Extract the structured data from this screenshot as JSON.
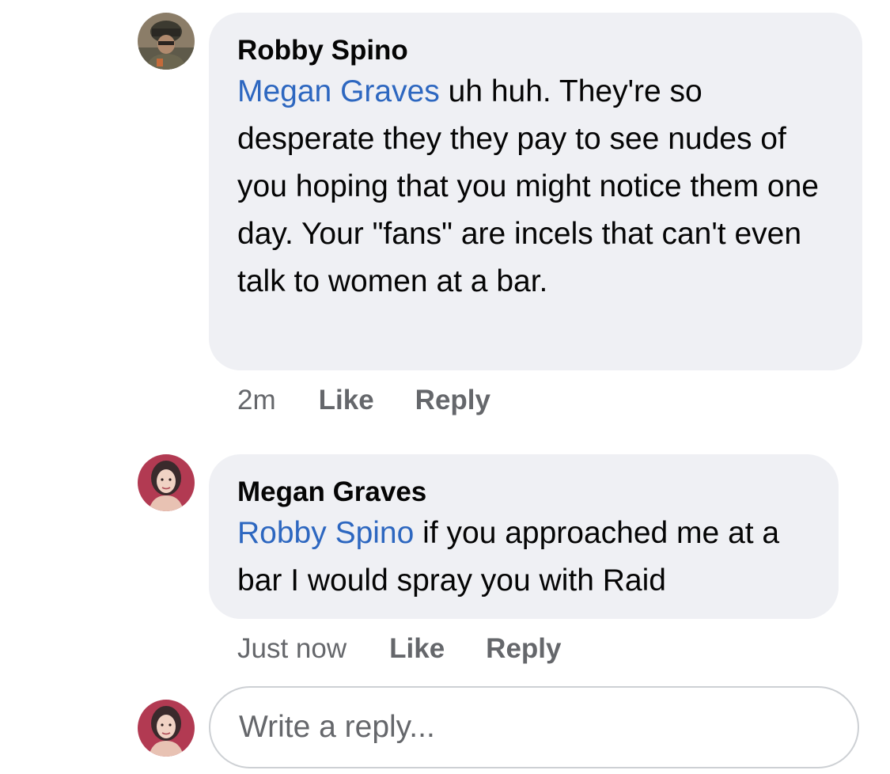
{
  "comments": [
    {
      "author": "Robby Spino",
      "mention": "Megan Graves",
      "text": " uh huh. They're so desperate they they pay to see nudes of you hoping that you might notice them one day. Your \"fans\" are incels that can't even talk to women at a bar.",
      "time": "2m",
      "like_label": "Like",
      "reply_label": "Reply",
      "avatar_icon": "user-avatar-helmet"
    },
    {
      "author": "Megan Graves",
      "mention": "Robby Spino",
      "text": " if you approached me at a bar I would spray you with Raid",
      "time": "Just now",
      "like_label": "Like",
      "reply_label": "Reply",
      "avatar_icon": "user-avatar-woman"
    }
  ],
  "composer": {
    "placeholder": "Write a reply...",
    "value": "",
    "avatar_icon": "user-avatar-woman"
  },
  "colors": {
    "bubble_bg": "#eff0f4",
    "mention": "#2d67c0",
    "meta": "#65676b",
    "text": "#050505",
    "input_border": "#cdd0d4"
  }
}
